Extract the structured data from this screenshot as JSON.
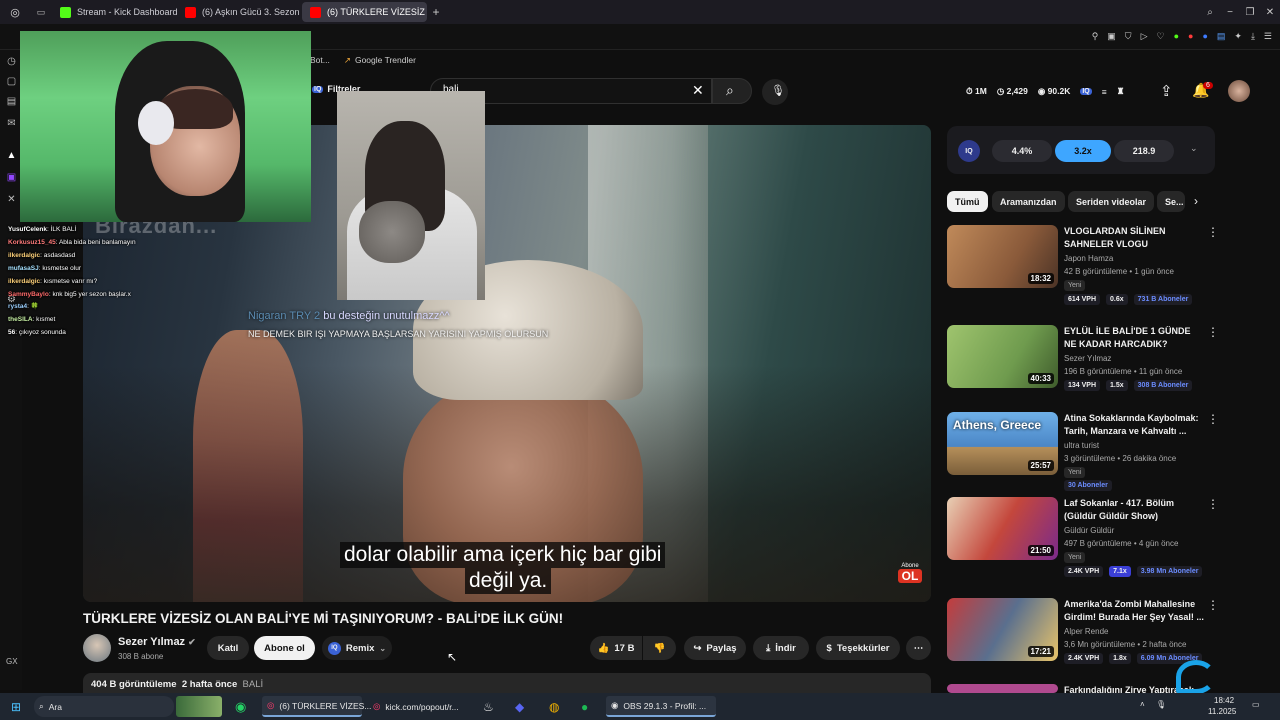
{
  "browser": {
    "tabs": [
      {
        "label": "Stream - Kick Dashboard",
        "color": "#53fc18"
      },
      {
        "label": "(6) Aşkın Gücü 3. Sezon",
        "color": "#ff0000"
      },
      {
        "label": "(6) TÜRKLERE VİZESİZ OL",
        "color": "#ff0000"
      }
    ],
    "new_tab_icon": "plus-icon",
    "bookmarks": [
      "Bot...",
      "Google Trendler"
    ]
  },
  "youtube": {
    "filter_label": "Filtreler",
    "search_value": "bali",
    "header_stats": {
      "likes": "1M",
      "comments": "2,429",
      "views": "90.2K"
    },
    "notification_count": "6"
  },
  "player": {
    "subtitle_line1": "dolar olabilir ama içerk hiç bar gibi",
    "subtitle_line2": "değil ya.",
    "subscribe_watermark_top": "Abone",
    "subscribe_watermark_bottom": "OL"
  },
  "stream_overlay": {
    "banner_text": "Birazdan...",
    "donation_name": "Nigaran TRY 2",
    "donation_text": " bu desteğin unutulmazz^^",
    "donation_sub": "NE DEMEK BIR IŞI YAPMAYA BAŞLARSAN YARISINI YAPMIŞ OLURSUN",
    "chat": [
      {
        "user": "YusufCelenk",
        "color": "#ffffff",
        "text": ": İLK BALİ"
      },
      {
        "user": "Korkusuz15_45",
        "color": "#ff7b7b",
        "text": ": Abla bida beni banlamayın"
      },
      {
        "user": "ilkerdalgic",
        "color": "#ffd27a",
        "text": ": asdasdasd"
      },
      {
        "user": "mufasaSJ",
        "color": "#a6e1ff",
        "text": ": kısmetse olur"
      },
      {
        "user": "ilkerdalgic",
        "color": "#ffd27a",
        "text": ": kısmetse varır mı?"
      },
      {
        "user": "SammyBaylo",
        "color": "#ff6b6b",
        "text": ": knk big5 yer sezon başlar.x"
      },
      {
        "user": "rysta4",
        "color": "#9bd0ff",
        "text": ": 🍀"
      },
      {
        "user": "theSILA",
        "color": "#c7f0a4",
        "text": ": kısmet"
      },
      {
        "user": "56",
        "color": "#ffffff",
        "text": ": çıkıyoz sonunda"
      }
    ]
  },
  "video": {
    "title": "TÜRKLERE VİZESİZ OLAN BALİ'YE Mİ TAŞINIYORUM? - BALİ'DE İLK GÜN!",
    "channel": "Sezer Yılmaz",
    "subscribers": "308 B abone",
    "join_label": "Katıl",
    "subscribe_label": "Abone ol",
    "remix_label": "Remix",
    "likes": "17 B",
    "share_label": "Paylaş",
    "download_label": "İndir",
    "thanks_label": "Teşekkürler",
    "views": "404 B görüntüleme",
    "age": "2 hafta önce",
    "tag": "BALİ"
  },
  "metrics": {
    "engagement": "4.4%",
    "multiplier": "3.2x",
    "score": "218.9"
  },
  "chips": [
    "Tümü",
    "Aramanızdan",
    "Seriden videolar",
    "Se..."
  ],
  "recommendations": [
    {
      "title": "VLOGLARDAN SİLİNEN SAHNELER VLOGU",
      "channel": "Japon Hamza",
      "meta": "42 B görüntüleme • 1 gün önce",
      "badge": "Yeni",
      "duration": "18:32",
      "vph": "614 VPH",
      "ratio": "0.6x",
      "subs": "731 B Aboneler",
      "thumb": "#8a5a3a"
    },
    {
      "title": "EYLÜL İLE BALİ'DE 1 GÜNDE NE KADAR HARCADIK?",
      "channel": "Sezer Yılmaz",
      "meta": "196 B görüntüleme • 11 gün önce",
      "badge": "",
      "duration": "40:33",
      "vph": "134 VPH",
      "ratio": "1.5x",
      "subs": "308 B Aboneler",
      "thumb": "#6f9b4e"
    },
    {
      "title": "Atina Sokaklarında Kaybolmak: Tarih, Manzara ve Kahvaltı ...",
      "channel": "ultra turist",
      "meta": "3 görüntüleme • 26 dakika önce",
      "badge": "Yeni",
      "duration": "25:57",
      "vph": "",
      "ratio": "",
      "subs": "30 Aboneler",
      "thumb": "#4a86c6",
      "thumb_text": "Athens, Greece"
    },
    {
      "title": "Laf Sokanlar - 417. Bölüm (Güldür Güldür Show)",
      "channel": "Güldür Güldür",
      "meta": "497 B görüntüleme • 4 gün önce",
      "badge": "Yeni",
      "duration": "21:50",
      "vph": "2.4K VPH",
      "ratio": "7.1x",
      "subs": "3.98 Mn Aboneler",
      "thumb": "#c4473c"
    },
    {
      "title": "Amerika'da Zombi Mahallesine Girdim! Burada Her Şey Yasal! ...",
      "channel": "Alper Rende",
      "meta": "3,6 Mn görüntüleme • 2 hafta önce",
      "badge": "",
      "duration": "17:21",
      "vph": "2.4K VPH",
      "ratio": "1.8x",
      "subs": "6.09 Mn Aboneler",
      "thumb": "#5a6f8e"
    },
    {
      "title": "Farkındalığını Zirve Yaptıracak",
      "channel": "",
      "meta": "",
      "badge": "",
      "duration": "",
      "thumb": "#b04a8f"
    }
  ],
  "taskbar": {
    "search_label": "Ara",
    "items": [
      "(6) TÜRKLERE VİZES...",
      "kick.com/popout/r...",
      "OBS 29.1.3 - Profil: ..."
    ],
    "time": "18:42",
    "date": "11.2025"
  },
  "colors": {
    "accent_blue": "#3ea6ff",
    "kick_green": "#53fc18",
    "yt_red": "#ff0000"
  }
}
